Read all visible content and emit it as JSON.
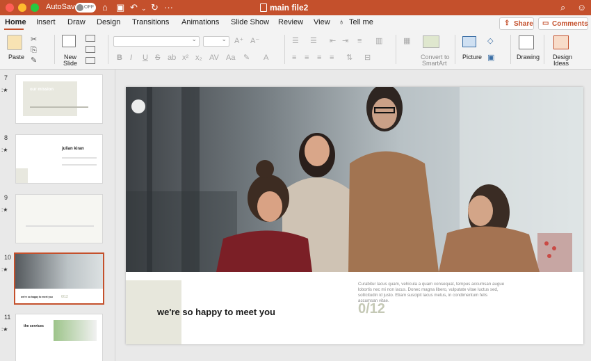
{
  "titlebar": {
    "autosave_label": "AutoSave",
    "autosave_state": "OFF",
    "doc_title": "main file2",
    "bg_color": "#c4502c"
  },
  "tabs": [
    "Home",
    "Insert",
    "Draw",
    "Design",
    "Transitions",
    "Animations",
    "Slide Show",
    "Review",
    "View",
    "Tell me"
  ],
  "actions": {
    "share": "Share",
    "comments": "Comments"
  },
  "ribbon": {
    "paste": "Paste",
    "new_slide_1": "New",
    "new_slide_2": "Slide",
    "convert_1": "Convert to",
    "convert_2": "SmartArt",
    "picture": "Picture",
    "drawing": "Drawing",
    "design_ideas_1": "Design",
    "design_ideas_2": "Ideas",
    "format_buttons": [
      "B",
      "I",
      "U",
      "S",
      "ab",
      "x²",
      "x₂",
      "AV",
      "Aa"
    ]
  },
  "thumbnails": [
    {
      "number": "7",
      "title": "our mission"
    },
    {
      "number": "8",
      "title": "julian kiran"
    },
    {
      "number": "9",
      "title": ""
    },
    {
      "number": "10",
      "title": "we're so happy to meet you"
    },
    {
      "number": "11",
      "title": "the services"
    }
  ],
  "slide": {
    "tagline": "we're so happy to meet you",
    "body": "Curabitur lacus quam, vehicula a quam consequat, tempus accumsan augue lobortis nec mi non lacus. Donec magna libero, vulputate vitae luctus sed, sollicitudin id justo. Etiam suscipit lacus metus, in condimentum felis accumsan vitae.",
    "counter": "0/12"
  }
}
